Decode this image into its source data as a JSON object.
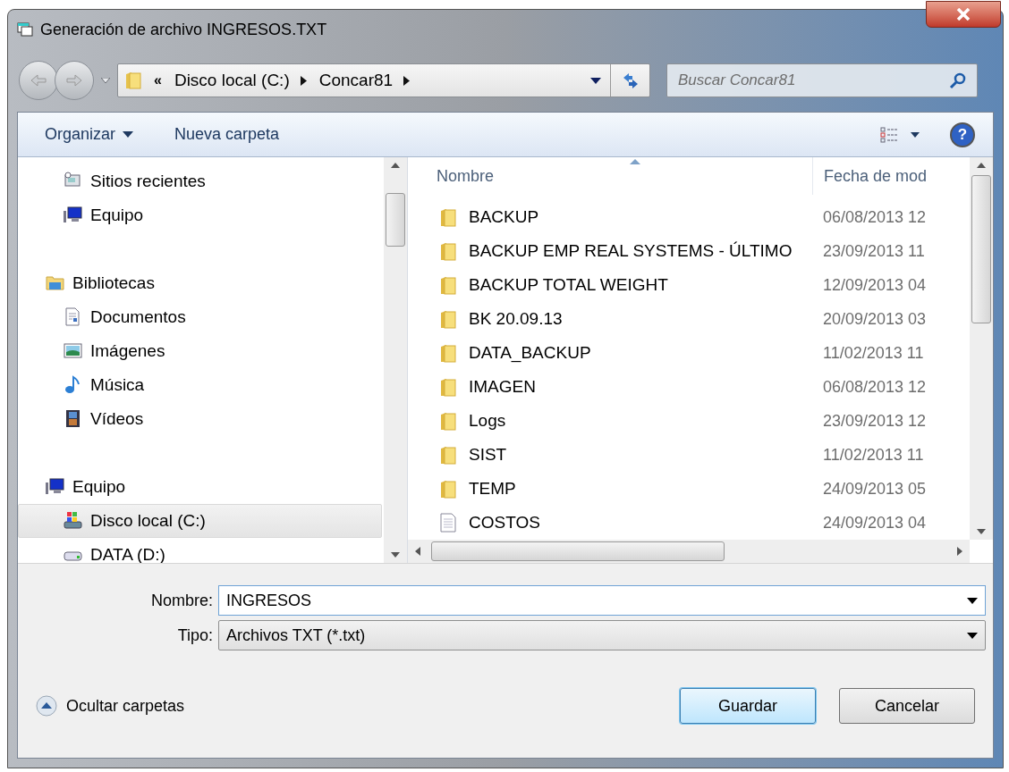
{
  "window": {
    "title": "Generación de archivo INGRESOS.TXT"
  },
  "address_bar": {
    "overflow": "«",
    "path": [
      "Disco local (C:)",
      "Concar81"
    ]
  },
  "search": {
    "placeholder": "Buscar Concar81"
  },
  "toolbar": {
    "buttons": [
      "Organizar",
      "Nueva carpeta"
    ],
    "help": "?"
  },
  "sidebar": {
    "sections": [
      {
        "children": [
          {
            "label": "Sitios recientes",
            "kind": "recent",
            "selected": false
          },
          {
            "label": "Equipo",
            "kind": "computer",
            "selected": false
          }
        ]
      },
      {
        "label": "Bibliotecas",
        "kind": "library",
        "selected": false,
        "children": [
          {
            "label": "Documentos",
            "kind": "documents",
            "selected": false
          },
          {
            "label": "Imágenes",
            "kind": "pictures",
            "selected": false
          },
          {
            "label": "Música",
            "kind": "music",
            "selected": false
          },
          {
            "label": "Vídeos",
            "kind": "videos",
            "selected": false
          }
        ]
      },
      {
        "label": "Equipo",
        "kind": "computer",
        "selected": false,
        "children": [
          {
            "label": "Disco local (C:)",
            "kind": "system-drive",
            "selected": true
          },
          {
            "label": "DATA (D:)",
            "kind": "drive",
            "selected": false
          }
        ]
      }
    ]
  },
  "file_list": {
    "columns": [
      "Nombre",
      "Fecha de mod"
    ],
    "rows": [
      {
        "name": "BACKUP",
        "kind": "folder",
        "date": "06/08/2013 12"
      },
      {
        "name": "BACKUP EMP REAL SYSTEMS - ÚLTIMO",
        "kind": "folder",
        "date": "23/09/2013 11"
      },
      {
        "name": "BACKUP TOTAL WEIGHT",
        "kind": "folder",
        "date": "12/09/2013 04"
      },
      {
        "name": "BK 20.09.13",
        "kind": "folder",
        "date": "20/09/2013 03"
      },
      {
        "name": "DATA_BACKUP",
        "kind": "folder",
        "date": "11/02/2013 11"
      },
      {
        "name": "IMAGEN",
        "kind": "folder",
        "date": "06/08/2013 12"
      },
      {
        "name": "Logs",
        "kind": "folder",
        "date": "23/09/2013 12"
      },
      {
        "name": "SIST",
        "kind": "folder",
        "date": "11/02/2013 11"
      },
      {
        "name": "TEMP",
        "kind": "folder",
        "date": "24/09/2013 05"
      },
      {
        "name": "COSTOS",
        "kind": "file",
        "date": "24/09/2013 04"
      }
    ]
  },
  "form": {
    "filename": {
      "label": "Nombre:",
      "value": "INGRESOS"
    },
    "type": {
      "label": "Tipo:",
      "value": "Archivos TXT (*.txt)"
    }
  },
  "footer": {
    "toggle": "Ocultar carpetas",
    "buttons": [
      {
        "label": "Guardar",
        "kind": "primary"
      },
      {
        "label": "Cancelar",
        "kind": "normal"
      }
    ]
  }
}
